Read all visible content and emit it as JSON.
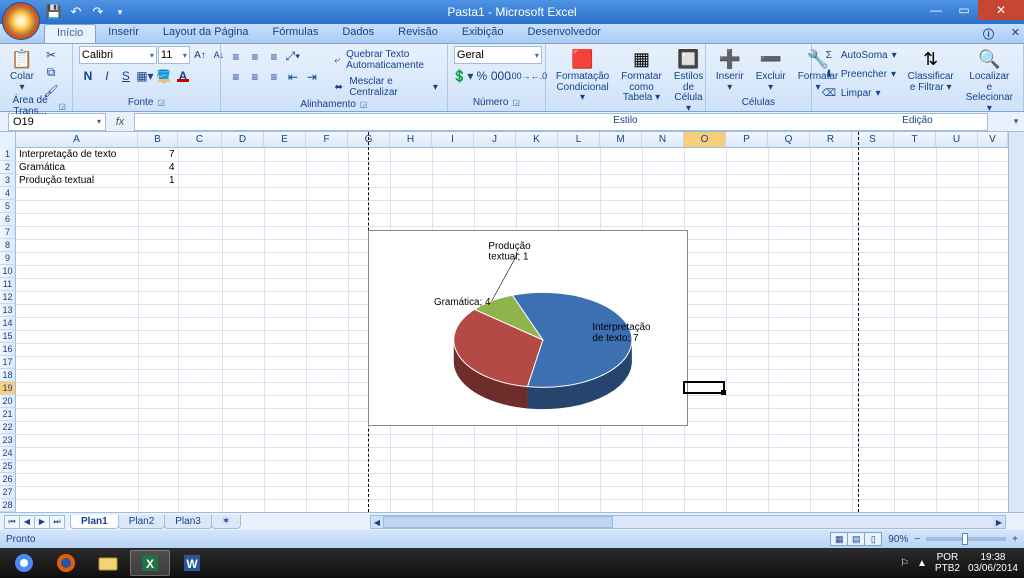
{
  "title": "Pasta1 - Microsoft Excel",
  "tabs": [
    "Início",
    "Inserir",
    "Layout da Página",
    "Fórmulas",
    "Dados",
    "Revisão",
    "Exibição",
    "Desenvolvedor"
  ],
  "activeTab": 0,
  "ribbon": {
    "clipboard": {
      "paste": "Colar",
      "group": "Área de Trans..."
    },
    "font": {
      "group": "Fonte",
      "name": "Calibri",
      "size": "11"
    },
    "align": {
      "group": "Alinhamento",
      "wrap": "Quebrar Texto Automaticamente",
      "merge": "Mesclar e Centralizar"
    },
    "number": {
      "group": "Número",
      "format": "Geral"
    },
    "styles": {
      "group": "Estilo",
      "cond": "Formatação Condicional",
      "table": "Formatar como Tabela",
      "cell": "Estilos de Célula"
    },
    "cells": {
      "group": "Células",
      "ins": "Inserir",
      "del": "Excluir",
      "fmt": "Formatar"
    },
    "editing": {
      "group": "Edição",
      "sum": "AutoSoma",
      "fill": "Preencher",
      "clear": "Limpar",
      "sort": "Classificar e Filtrar",
      "find": "Localizar e Selecionar"
    }
  },
  "namebox": "O19",
  "cols": [
    "A",
    "B",
    "C",
    "D",
    "E",
    "F",
    "G",
    "H",
    "I",
    "J",
    "K",
    "L",
    "M",
    "N",
    "O",
    "P",
    "Q",
    "R",
    "S",
    "T",
    "U",
    "V"
  ],
  "selColIndex": 14,
  "selRowIndex": 18,
  "rows28": 28,
  "data_rows": [
    {
      "a": "Interpretação de texto",
      "b": "7"
    },
    {
      "a": "Gramática",
      "b": "4"
    },
    {
      "a": "Produção textual",
      "b": "1"
    }
  ],
  "chart_data": {
    "type": "pie",
    "categories": [
      "Interpretação de texto",
      "Gramática",
      "Produção textual"
    ],
    "values": [
      7,
      4,
      1
    ],
    "labels": [
      "Interpretação de texto; 7",
      "Gramática; 4",
      "Produção textual; 1"
    ],
    "colors": [
      "#3d6fb3",
      "#b34a46",
      "#8fb44c"
    ]
  },
  "sheets": [
    "Plan1",
    "Plan2",
    "Plan3"
  ],
  "activeSheet": 0,
  "status": {
    "ready": "Pronto",
    "zoom": "90%"
  },
  "tray": {
    "lang1": "POR",
    "lang2": "PTB2",
    "time": "19:38",
    "date": "03/06/2014"
  }
}
